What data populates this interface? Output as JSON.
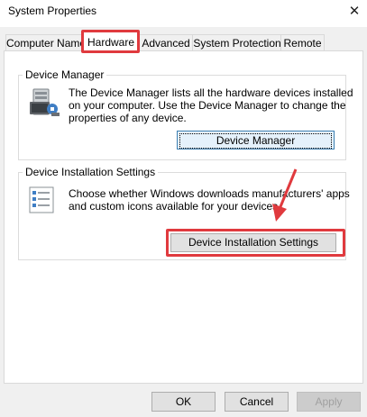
{
  "window": {
    "title": "System Properties",
    "close_glyph": "✕"
  },
  "tabs": [
    {
      "label": "Computer Name"
    },
    {
      "label": "Hardware",
      "active": true
    },
    {
      "label": "Advanced"
    },
    {
      "label": "System Protection"
    },
    {
      "label": "Remote"
    }
  ],
  "device_manager": {
    "group_label": "Device Manager",
    "description": "The Device Manager lists all the hardware devices installed on your computer. Use the Device Manager to change the properties of any device.",
    "desc_lines": [
      "The Device Manager lists all the hardware devices installed",
      "on your computer. Use the Device Manager to change the",
      "properties of any device."
    ],
    "button_label": "Device Manager",
    "icon": "device-manager-icon"
  },
  "device_installation": {
    "group_label": "Device Installation Settings",
    "desc_lines": [
      "Choose whether Windows downloads manufacturers' apps",
      "and custom icons available for your devices."
    ],
    "button_label": "Device Installation Settings",
    "icon": "checklist-icon"
  },
  "footer": {
    "ok_label": "OK",
    "cancel_label": "Cancel",
    "apply_label": "Apply"
  },
  "colors": {
    "highlight": "#e03a3e",
    "focus_border": "#3c7fb1"
  }
}
